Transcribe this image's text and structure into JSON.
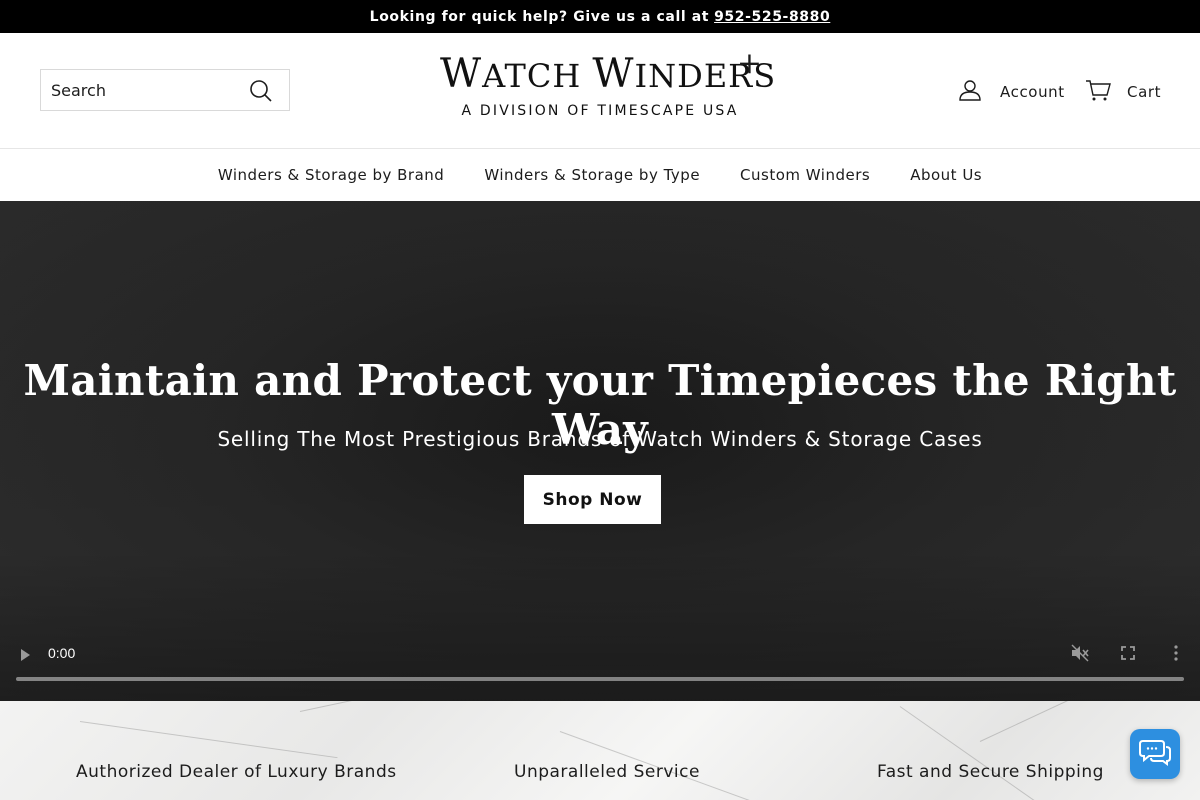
{
  "announcement": {
    "text": "Looking for quick help? Give us a call at",
    "phone": "952-525-8880"
  },
  "header": {
    "search_placeholder": "Search",
    "logo_line1_w": "W",
    "logo_line1_rest1": "ATCH ",
    "logo_line1_w2": "W",
    "logo_line1_rest2": "INDERS",
    "logo_plus": "+",
    "logo_sub": "A DIVISION OF TIMESCAPE USA",
    "account_label": "Account",
    "cart_label": "Cart"
  },
  "nav": {
    "items": [
      {
        "label": "Winders & Storage by Brand"
      },
      {
        "label": "Winders & Storage by Type"
      },
      {
        "label": "Custom Winders"
      },
      {
        "label": "About Us"
      }
    ]
  },
  "hero": {
    "title": "Maintain and Protect your Timepieces the Right Way",
    "subtitle": "Selling The Most Prestigious Brands of Watch Winders & Storage Cases",
    "button_label": "Shop Now"
  },
  "video": {
    "time": "0:00",
    "progress": 0
  },
  "features": {
    "items": [
      {
        "label": "Authorized Dealer of Luxury Brands"
      },
      {
        "label": "Unparalleled Service"
      },
      {
        "label": "Fast and Secure Shipping"
      }
    ]
  },
  "icons": {
    "search": "search-icon",
    "account": "user-icon",
    "cart": "cart-icon",
    "play": "play-icon",
    "mute": "muted-icon",
    "fullscreen": "fullscreen-icon",
    "more": "more-vertical-icon",
    "chat": "chat-icon"
  },
  "colors": {
    "announcement_bg": "#000000",
    "hero_bg": "#262626",
    "chat_button": "#2d8fe0"
  }
}
